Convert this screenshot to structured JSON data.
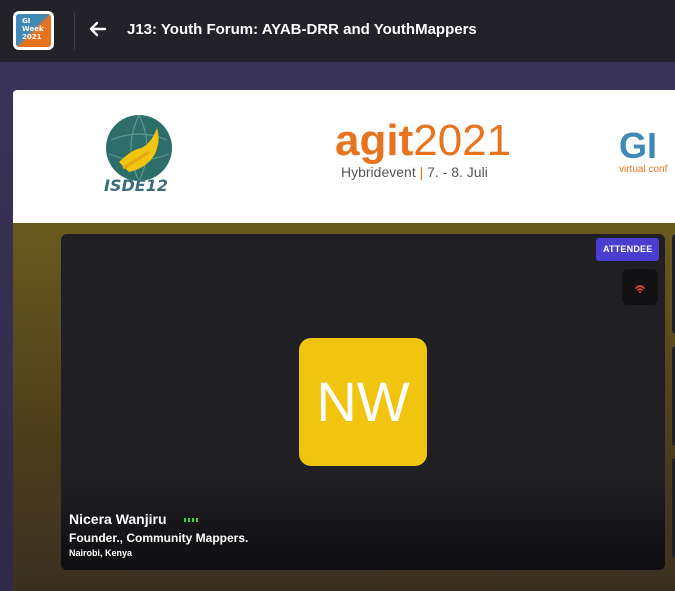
{
  "app": {
    "logo_text": [
      "GI",
      "Week",
      "2021"
    ],
    "title": "J13: Youth Forum: AYAB-DRR and YouthMappers",
    "back_icon": "arrow-left-icon"
  },
  "banner": {
    "isde_label": "ISDE12",
    "agit_bold": "agit",
    "agit_year": "2021",
    "agit_sub_left": "Hybridevent",
    "agit_sub_sep": "|",
    "agit_sub_right": "7. - 8. Juli",
    "gi_text": "GI",
    "gi_sub": "virtual conf"
  },
  "participant": {
    "initials": "NW",
    "avatar_color": "#f1c40f",
    "name": "Nicera Wanjiru",
    "role": "Founder., Community Mappers.",
    "location": "Nairobi, Kenya",
    "badge": "ATTENDEE",
    "badge_color": "#4a3ed0",
    "connection_icon": "weak-signal-icon",
    "audio_level_icon": "audio-level-icon"
  },
  "colors": {
    "topbar": "#222228",
    "tile": "#1f1f24",
    "accent_orange": "#e8731f",
    "accent_blue": "#3f89b8",
    "audio_green": "#3bd24a",
    "signal_red": "#e74c3c"
  }
}
